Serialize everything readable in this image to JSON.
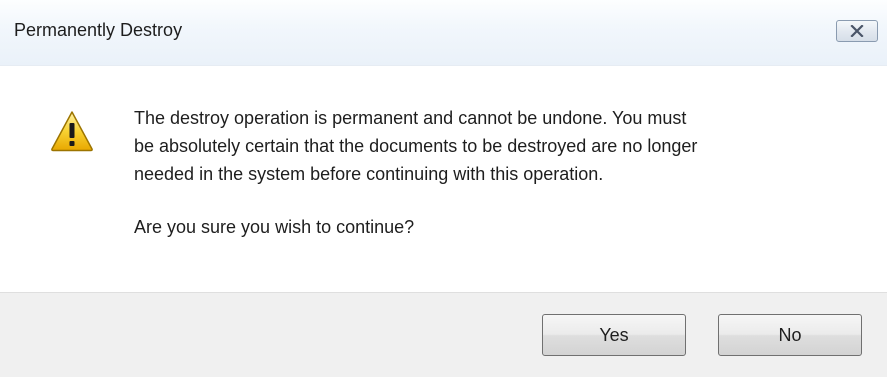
{
  "window": {
    "title": "Permanently Destroy"
  },
  "icons": {
    "close": "close-icon",
    "warning": "warning-icon"
  },
  "message": {
    "line1": "The destroy operation is permanent and cannot be undone.  You must",
    "line2": "be absolutely certain that the documents to be destroyed are no longer",
    "line3": "needed in the system before continuing with this operation.",
    "question": "Are you sure you wish to continue?"
  },
  "buttons": {
    "yes_label": "Yes",
    "no_label": "No"
  },
  "colors": {
    "warning_fill": "#f5c518",
    "warning_stroke": "#b08500",
    "footer_background": "#f0f0f0",
    "title_bar_tint": "#eaf1f9"
  }
}
